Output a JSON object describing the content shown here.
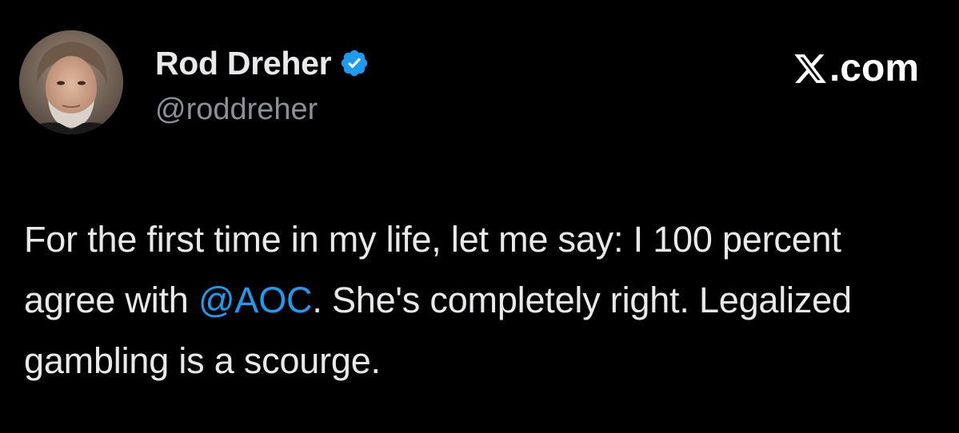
{
  "author": {
    "display_name": "Rod Dreher",
    "handle": "@roddreher",
    "verified_icon": "verified-badge-icon",
    "avatar_icon": "profile-photo"
  },
  "site": {
    "logo_icon": "x-logo-icon",
    "domain": ".com"
  },
  "tweet": {
    "text_before": "For the first time in my life, let me say: I 100 percent agree with ",
    "mention": "@AOC",
    "text_after": ". She's completely right. Legalized gambling is a scourge."
  },
  "colors": {
    "background": "#000000",
    "primary_text": "#e7e9ea",
    "secondary_text": "#8b9098",
    "link": "#1d9bf0",
    "verified_badge": "#1d9bf0"
  }
}
